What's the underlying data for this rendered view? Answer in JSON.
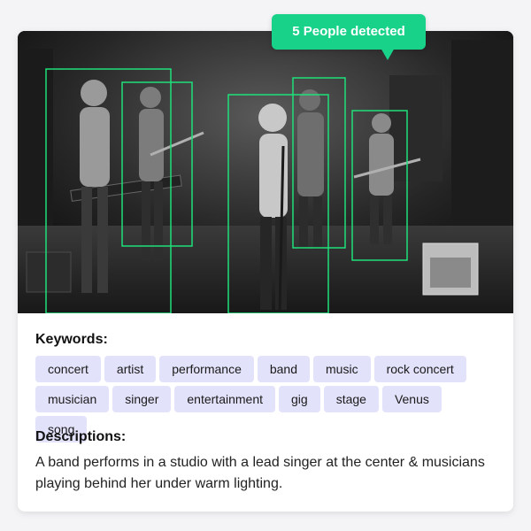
{
  "badge": {
    "label": "5 People detected"
  },
  "colors": {
    "accent": "#18d28a",
    "detection_box": "#1ee07a",
    "tag_bg": "#e2e2fb"
  },
  "photo": {
    "subject": "black and white band performance in studio",
    "detections": [
      {
        "name": "keyboard-player"
      },
      {
        "name": "guitarist-left"
      },
      {
        "name": "lead-singer"
      },
      {
        "name": "guitarist-back"
      },
      {
        "name": "guitarist-right"
      }
    ]
  },
  "keywords": {
    "title": "Keywords:",
    "items": [
      "concert",
      "artist",
      "performance",
      "band",
      "music",
      "rock concert",
      "musician",
      "singer",
      "entertainment",
      "gig",
      "stage",
      "Venus",
      "song"
    ]
  },
  "descriptions": {
    "title": "Descriptions:",
    "text": "A band performs in a studio with a lead singer at the center & musicians playing behind her under warm lighting."
  }
}
